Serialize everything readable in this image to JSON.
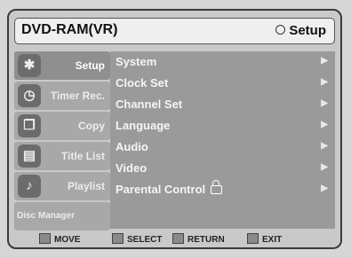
{
  "header": {
    "title": "DVD-RAM(VR)",
    "mode_label": "Setup"
  },
  "sidebar": {
    "items": [
      {
        "label": "Setup",
        "icon": "setup-icon"
      },
      {
        "label": "Timer Rec.",
        "icon": "timer-icon"
      },
      {
        "label": "Copy",
        "icon": "copy-icon"
      },
      {
        "label": "Title List",
        "icon": "title-list-icon"
      },
      {
        "label": "Playlist",
        "icon": "playlist-icon"
      },
      {
        "label": "Disc Manager",
        "icon": "disc-icon"
      }
    ]
  },
  "menu": {
    "items": [
      {
        "label": "System"
      },
      {
        "label": "Clock Set"
      },
      {
        "label": "Channel Set"
      },
      {
        "label": "Language"
      },
      {
        "label": "Audio"
      },
      {
        "label": "Video"
      },
      {
        "label": "Parental Control"
      }
    ]
  },
  "footer": {
    "move": "MOVE",
    "select": "SELECT",
    "return": "RETURN",
    "exit": "EXIT"
  }
}
